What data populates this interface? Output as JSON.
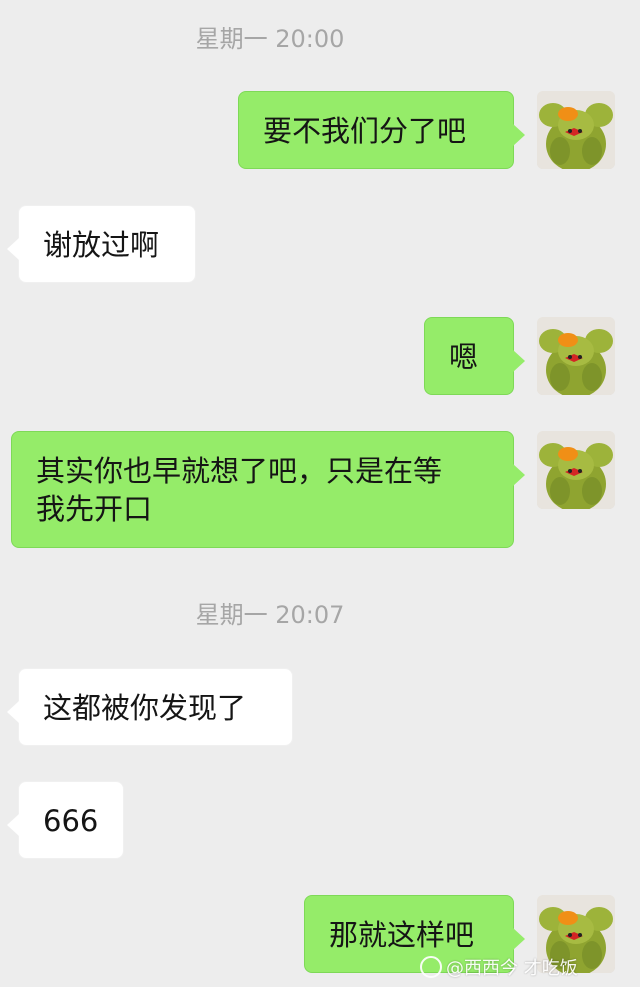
{
  "chat": {
    "timestamps": [
      "星期一 20:00",
      "星期一 20:07"
    ],
    "messages": [
      {
        "text": "要不我们分了吧"
      },
      {
        "text": "谢放过啊"
      },
      {
        "text": "嗯"
      },
      {
        "text": "其实你也早就想了吧，只是在等\n我先开口"
      },
      {
        "text": "这都被你发现了"
      },
      {
        "text": "666"
      },
      {
        "text": "那就这样吧"
      }
    ]
  },
  "avatar": {
    "icon": "frog-plush-avatar"
  },
  "watermark": {
    "icon": "weibo-icon",
    "text": "@西西今 才吃饭"
  },
  "colors": {
    "background": "#ededed",
    "outgoing_bubble": "#95ec69",
    "incoming_bubble": "#ffffff",
    "timestamp": "#a6a6a6"
  }
}
